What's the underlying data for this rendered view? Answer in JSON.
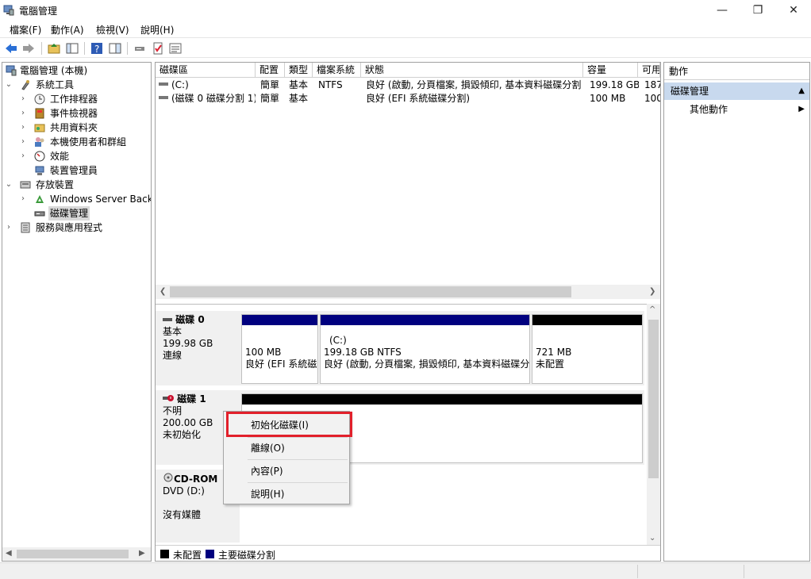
{
  "window": {
    "title": "電腦管理",
    "minimize": "—",
    "maximize": "❐",
    "close": "✕"
  },
  "menu": [
    "檔案(F)",
    "動作(A)",
    "檢視(V)",
    "說明(H)"
  ],
  "tree": {
    "root": "電腦管理 (本機)",
    "system_tools": "系統工具",
    "task_scheduler": "工作排程器",
    "event_viewer": "事件檢視器",
    "shared_folders": "共用資料夾",
    "local_users": "本機使用者和群組",
    "performance": "效能",
    "device_manager": "裝置管理員",
    "storage": "存放裝置",
    "windows_backup": "Windows Server Backu",
    "disk_management": "磁碟管理",
    "services_apps": "服務與應用程式"
  },
  "volumes": {
    "headers": [
      "磁碟區",
      "配置",
      "類型",
      "檔案系統",
      "狀態",
      "容量",
      "可用"
    ],
    "rows": [
      [
        "(C:)",
        "簡單",
        "基本",
        "NTFS",
        "良好 (啟動, 分頁檔案, 損毀傾印, 基本資料磁碟分割)",
        "199.18 GB",
        "187"
      ],
      [
        "(磁碟 0 磁碟分割 1)",
        "簡單",
        "基本",
        "",
        "良好 (EFI 系統磁碟分割)",
        "100 MB",
        "100"
      ]
    ]
  },
  "disks": {
    "disk0": {
      "name": "磁碟 0",
      "type": "基本",
      "size": "199.98 GB",
      "status": "連線",
      "p1_size": "100 MB",
      "p1_status": "良好 (EFI 系統磁",
      "p2_label": "(C:)",
      "p2_size": "199.18 GB NTFS",
      "p2_status": "良好 (啟動, 分頁檔案, 損毀傾印, 基本資料磁碟分",
      "p3_size": "721 MB",
      "p3_status": "未配置"
    },
    "disk1": {
      "name": "磁碟 1",
      "type": "不明",
      "size": "200.00 GB",
      "status": "未初始化"
    },
    "cdrom": {
      "name": "CD-ROM",
      "drive": "DVD (D:)",
      "media": "沒有媒體"
    }
  },
  "context_menu": {
    "initialize": "初始化磁碟(I)",
    "offline": "離線(O)",
    "properties": "內容(P)",
    "help": "說明(H)"
  },
  "legend": {
    "unallocated": "未配置",
    "primary": "主要磁碟分割"
  },
  "actions": {
    "title": "動作",
    "group": "磁碟管理",
    "more": "其他動作"
  },
  "colors": {
    "primary_partition": "#00007f",
    "unallocated": "#000000",
    "highlight_box": "#e2202b",
    "action_group_bg": "#c8d9ee"
  }
}
